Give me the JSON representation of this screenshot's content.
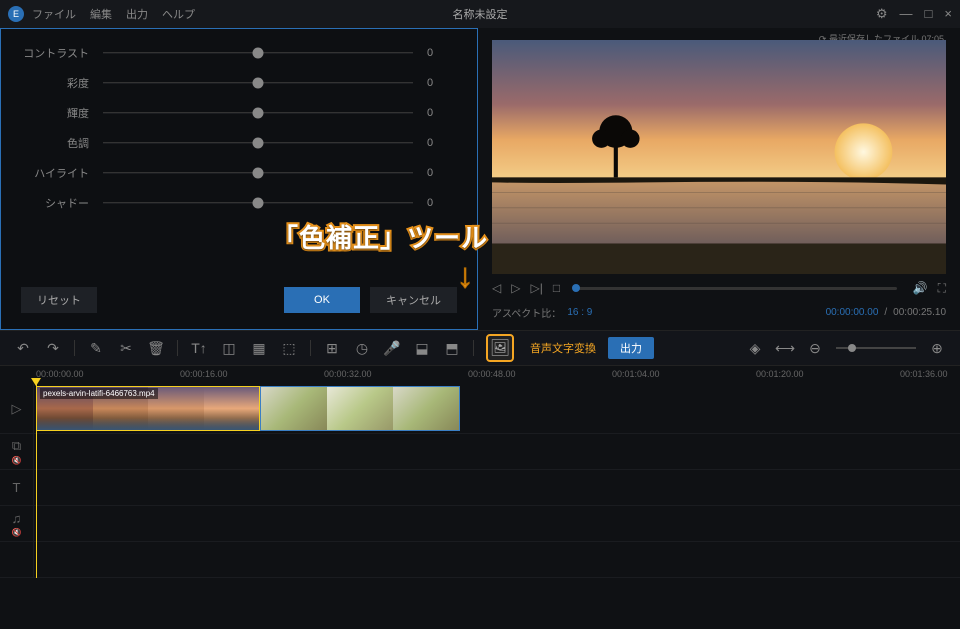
{
  "titlebar": {
    "menus": [
      "ファイル",
      "編集",
      "出力",
      "ヘルプ"
    ],
    "title": "名称未設定",
    "win": {
      "min": "—",
      "max": "□",
      "close": "×"
    }
  },
  "recent_save": "⟳ 最近保存したファイル 07:05",
  "color_panel": {
    "sliders": [
      {
        "label": "コントラスト",
        "value": "0"
      },
      {
        "label": "彩度",
        "value": "0"
      },
      {
        "label": "輝度",
        "value": "0"
      },
      {
        "label": "色調",
        "value": "0"
      },
      {
        "label": "ハイライト",
        "value": "0"
      },
      {
        "label": "シャドー",
        "value": "0"
      }
    ],
    "reset": "リセット",
    "ok": "OK",
    "cancel": "キャンセル"
  },
  "transport": {
    "prev": "◁",
    "play": "▷",
    "next": "▷|",
    "stop": "□",
    "vol": "🔊",
    "full": "⛶"
  },
  "aspect": {
    "label": "アスペクト比：",
    "value": "16 : 9",
    "current": "00:00:00.00",
    "total": "00:00:25.10"
  },
  "toolbar": {
    "undo": "↶",
    "redo": "↷",
    "edit": "✎",
    "cut": "✂",
    "delete": "🗑",
    "t1": "T↑",
    "crop": "◫",
    "mosaic": "▦",
    "t4": "⬚",
    "t5": "⊞",
    "clock": "◷",
    "mic": "🎤",
    "t8": "⬓",
    "t9": "⬒",
    "color_correct": "🖼",
    "audio_text": "音声文字変換",
    "export": "出力",
    "marker": "◈",
    "fit": "⟷",
    "zoom_out": "⊖",
    "zoom_in": "⊕"
  },
  "ruler": [
    "00:00:00.00",
    "00:00:16.00",
    "00:00:32.00",
    "00:00:48.00",
    "00:01:04.00",
    "00:01:20.00",
    "00:01:36.00"
  ],
  "tracks": {
    "video_icon": "▷",
    "pip_icon": "⧉",
    "text_icon": "T",
    "audio_icon": "♫"
  },
  "clip": {
    "filename": "pexels-arvin-latifi-6466763.mp4"
  },
  "callout": "「色補正」ツール",
  "arrow": "↓"
}
